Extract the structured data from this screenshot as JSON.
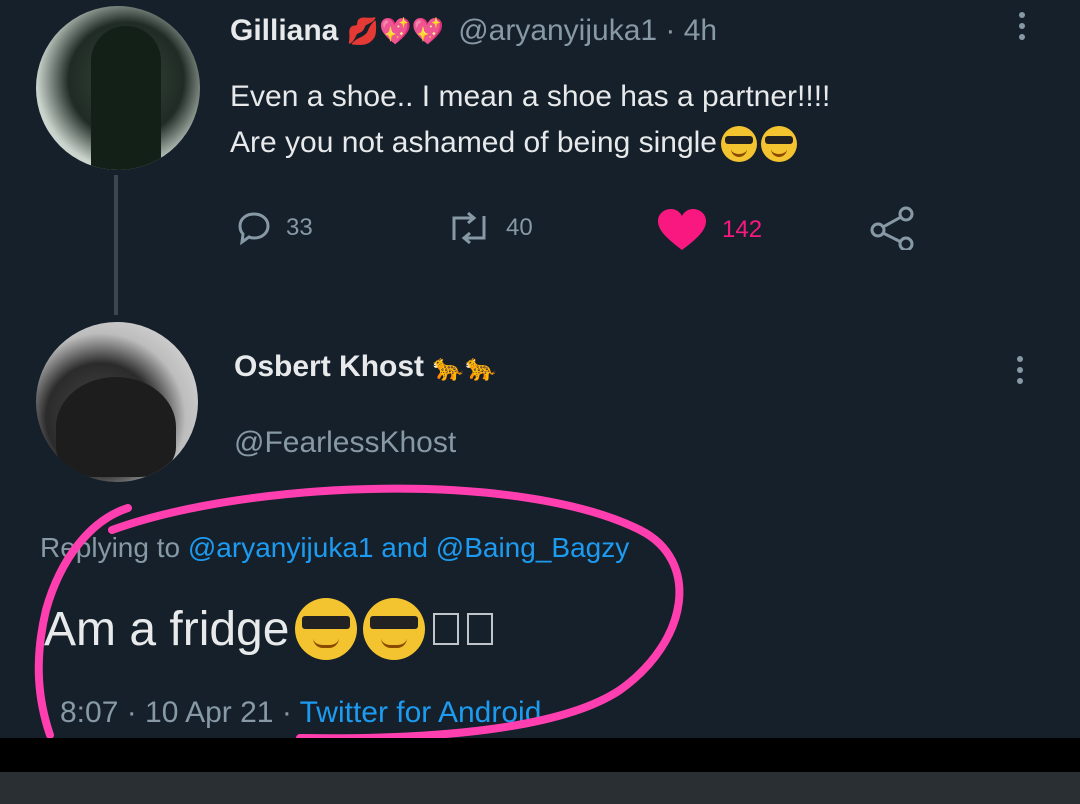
{
  "tweet1": {
    "name": "Gilliana",
    "name_emojis": "💋💖💖",
    "handle": "@aryanyijuka1",
    "time": "· 4h",
    "text_line1": "Even a shoe.. I mean a shoe has a partner!!!!",
    "text_line2": "Are you not ashamed of being single",
    "actions": {
      "replies": "33",
      "retweets": "40",
      "likes": "142"
    }
  },
  "tweet2": {
    "name": "Osbert Khost",
    "name_emojis": "🐆🐆",
    "handle": "@FearlessKhost",
    "replying_prefix": "Replying to",
    "reply_handle1": "@aryanyijuka1",
    "reply_and": "and",
    "reply_handle2": "@Baing_Bagzy",
    "text": "Am a fridge",
    "timestamp": "8:07 · 10 Apr 21 ·",
    "source": "Twitter for Android"
  },
  "colors": {
    "background": "#15202b",
    "accent": "#1d9bf0",
    "like": "#f91880",
    "highlight_circle": "#ff3fb0"
  }
}
